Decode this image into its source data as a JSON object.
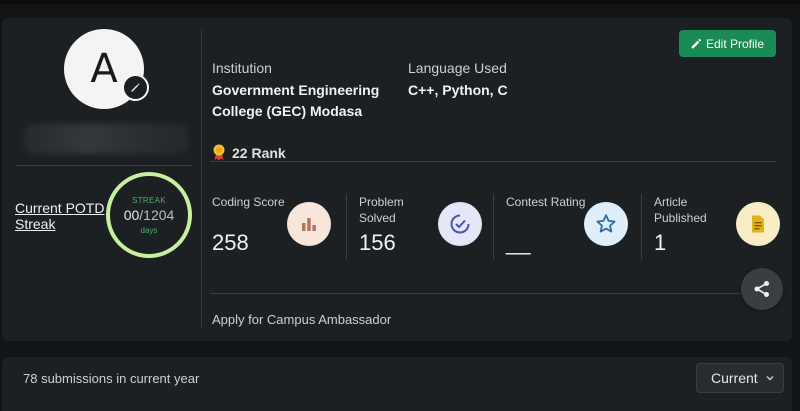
{
  "profile": {
    "avatar_initial": "A",
    "edit_profile_label": "Edit Profile",
    "potd_link": "Current POTD Streak",
    "streak": {
      "title": "STREAK",
      "current": "00",
      "total": "/1204",
      "unit": "days"
    }
  },
  "info": {
    "institution_label": "Institution",
    "institution_value": "Government Engineering College (GEC) Modasa",
    "language_label": "Language Used",
    "language_value": "C++, Python, C",
    "rank": "22 Rank"
  },
  "stats": [
    {
      "label": "Coding Score",
      "value": "258",
      "icon": "bar-chart-icon"
    },
    {
      "label": "Problem Solved",
      "value": "156",
      "icon": "check-circle-icon"
    },
    {
      "label": "Contest Rating",
      "value": "__",
      "icon": "star-icon"
    },
    {
      "label": "Article Published",
      "value": "1",
      "icon": "article-icon"
    }
  ],
  "campus_link": "Apply for Campus Ambassador",
  "submissions": {
    "text": "78 submissions in current year",
    "selected": "Current"
  },
  "colors": {
    "accent_green": "#1a8a57",
    "streak_ring": "#c7ef9f",
    "card_bg": "#1d2022"
  }
}
